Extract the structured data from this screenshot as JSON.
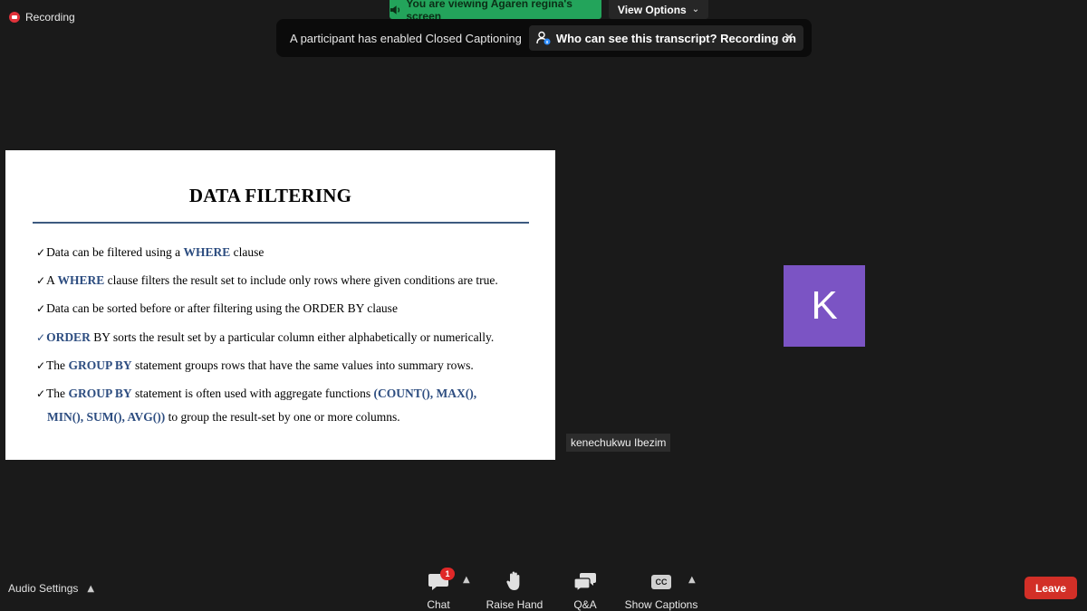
{
  "recording": {
    "label": "Recording"
  },
  "banner": {
    "viewing_text": "You are viewing Agaren regina's screen",
    "view_options_label": "View Options"
  },
  "caption_notice": {
    "message": "A participant has enabled Closed Captioning",
    "link_label": "Who can see this transcript? Recording on"
  },
  "slide": {
    "title": "DATA FILTERING",
    "bullets": {
      "b1": {
        "pre": "Data can be filtered using a ",
        "kw1": "WHERE",
        "post": " clause"
      },
      "b2": {
        "pre": "A ",
        "kw1": "WHERE",
        "post": " clause filters the result set to include only rows where given conditions are true."
      },
      "b3": {
        "text": "Data can be sorted before or after filtering using the ORDER BY clause"
      },
      "b4": {
        "kw1": "ORDER",
        "post": " BY sorts the result set by a particular column either alphabetically or numerically."
      },
      "b5": {
        "pre": "The ",
        "kw1": "GROUP BY",
        "post": " statement groups rows that have the same values into summary rows."
      },
      "b6": {
        "pre": "The ",
        "kw1": "GROUP BY",
        "mid": " statement is often used with aggregate functions ",
        "kw2": "(COUNT(), MAX(),",
        "kw3": "MIN(), SUM(), AVG())",
        "post": " to group the result-set by one or more columns."
      }
    }
  },
  "participant": {
    "initial": "K",
    "name": "kenechukwu Ibezim",
    "avatar_color": "#7b54c4"
  },
  "toolbar": {
    "audio_settings_label": "Audio Settings",
    "chat_label": "Chat",
    "chat_badge": "1",
    "raise_hand_label": "Raise Hand",
    "qa_label": "Q&A",
    "show_captions_label": "Show Captions",
    "cc_glyph": "CC",
    "leave_label": "Leave"
  },
  "colors": {
    "banner_green": "#23a45b",
    "leave_red": "#d22f27",
    "keyword_blue": "#2d4d80"
  }
}
